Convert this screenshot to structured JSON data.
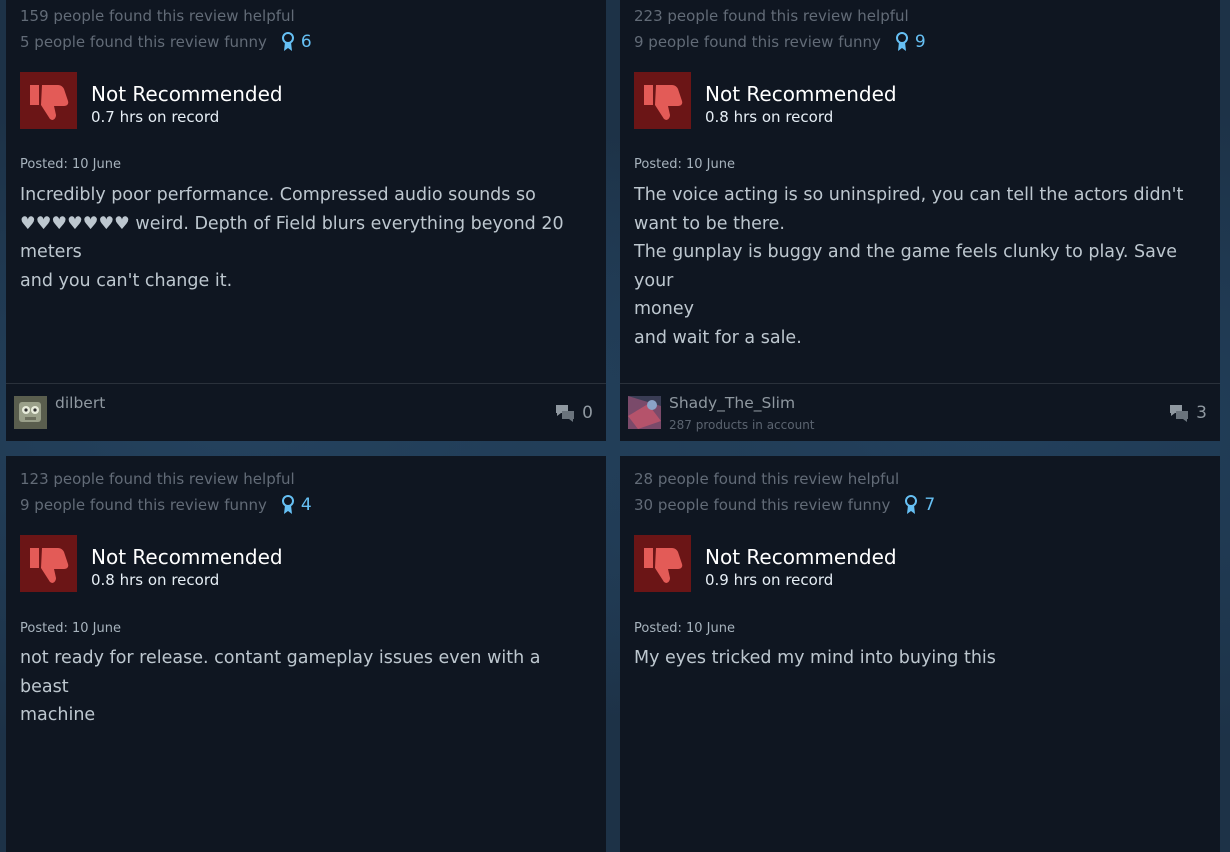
{
  "reviews": [
    {
      "helpful": "159 people found this review helpful",
      "funny": "5 people found this review funny",
      "awards": "6",
      "recommendation": "Not Recommended",
      "hours": "0.7 hrs on record",
      "posted": "Posted: 10 June",
      "body": "Incredibly poor performance. Compressed audio sounds so\n♥♥♥♥♥♥♥ weird. Depth of Field blurs everything beyond 20 meters\nand you can't change it.",
      "author": "dilbert",
      "products": "",
      "comments": "0",
      "avatar_icon": "robot-avatar-icon"
    },
    {
      "helpful": "223 people found this review helpful",
      "funny": "9 people found this review funny",
      "awards": "9",
      "recommendation": "Not Recommended",
      "hours": "0.8 hrs on record",
      "posted": "Posted: 10 June",
      "body": "The voice acting is so uninspired, you can tell the actors didn't\nwant to be there.\nThe gunplay is buggy and the game feels clunky to play. Save your\nmoney\nand wait for a sale.",
      "author": "Shady_The_Slim",
      "products": "287 products in account",
      "comments": "3",
      "avatar_icon": "art-avatar-icon"
    },
    {
      "helpful": "123 people found this review helpful",
      "funny": "9 people found this review funny",
      "awards": "4",
      "recommendation": "Not Recommended",
      "hours": "0.8 hrs on record",
      "posted": "Posted: 10 June",
      "body": "not ready for release. contant gameplay issues even with a beast\nmachine",
      "author": "",
      "products": "",
      "comments": "",
      "avatar_icon": ""
    },
    {
      "helpful": "28 people found this review helpful",
      "funny": "30 people found this review funny",
      "awards": "7",
      "recommendation": "Not Recommended",
      "hours": "0.9 hrs on record",
      "posted": "Posted: 10 June",
      "body": "My eyes tricked my mind into buying this",
      "author": "",
      "products": "",
      "comments": "",
      "avatar_icon": ""
    }
  ],
  "colors": {
    "card_bg": "#0f1621",
    "thumb_bg": "#6b1516",
    "thumb_fg": "#e35b57",
    "award": "#66c0f4",
    "page_bg": "#1d3247"
  }
}
